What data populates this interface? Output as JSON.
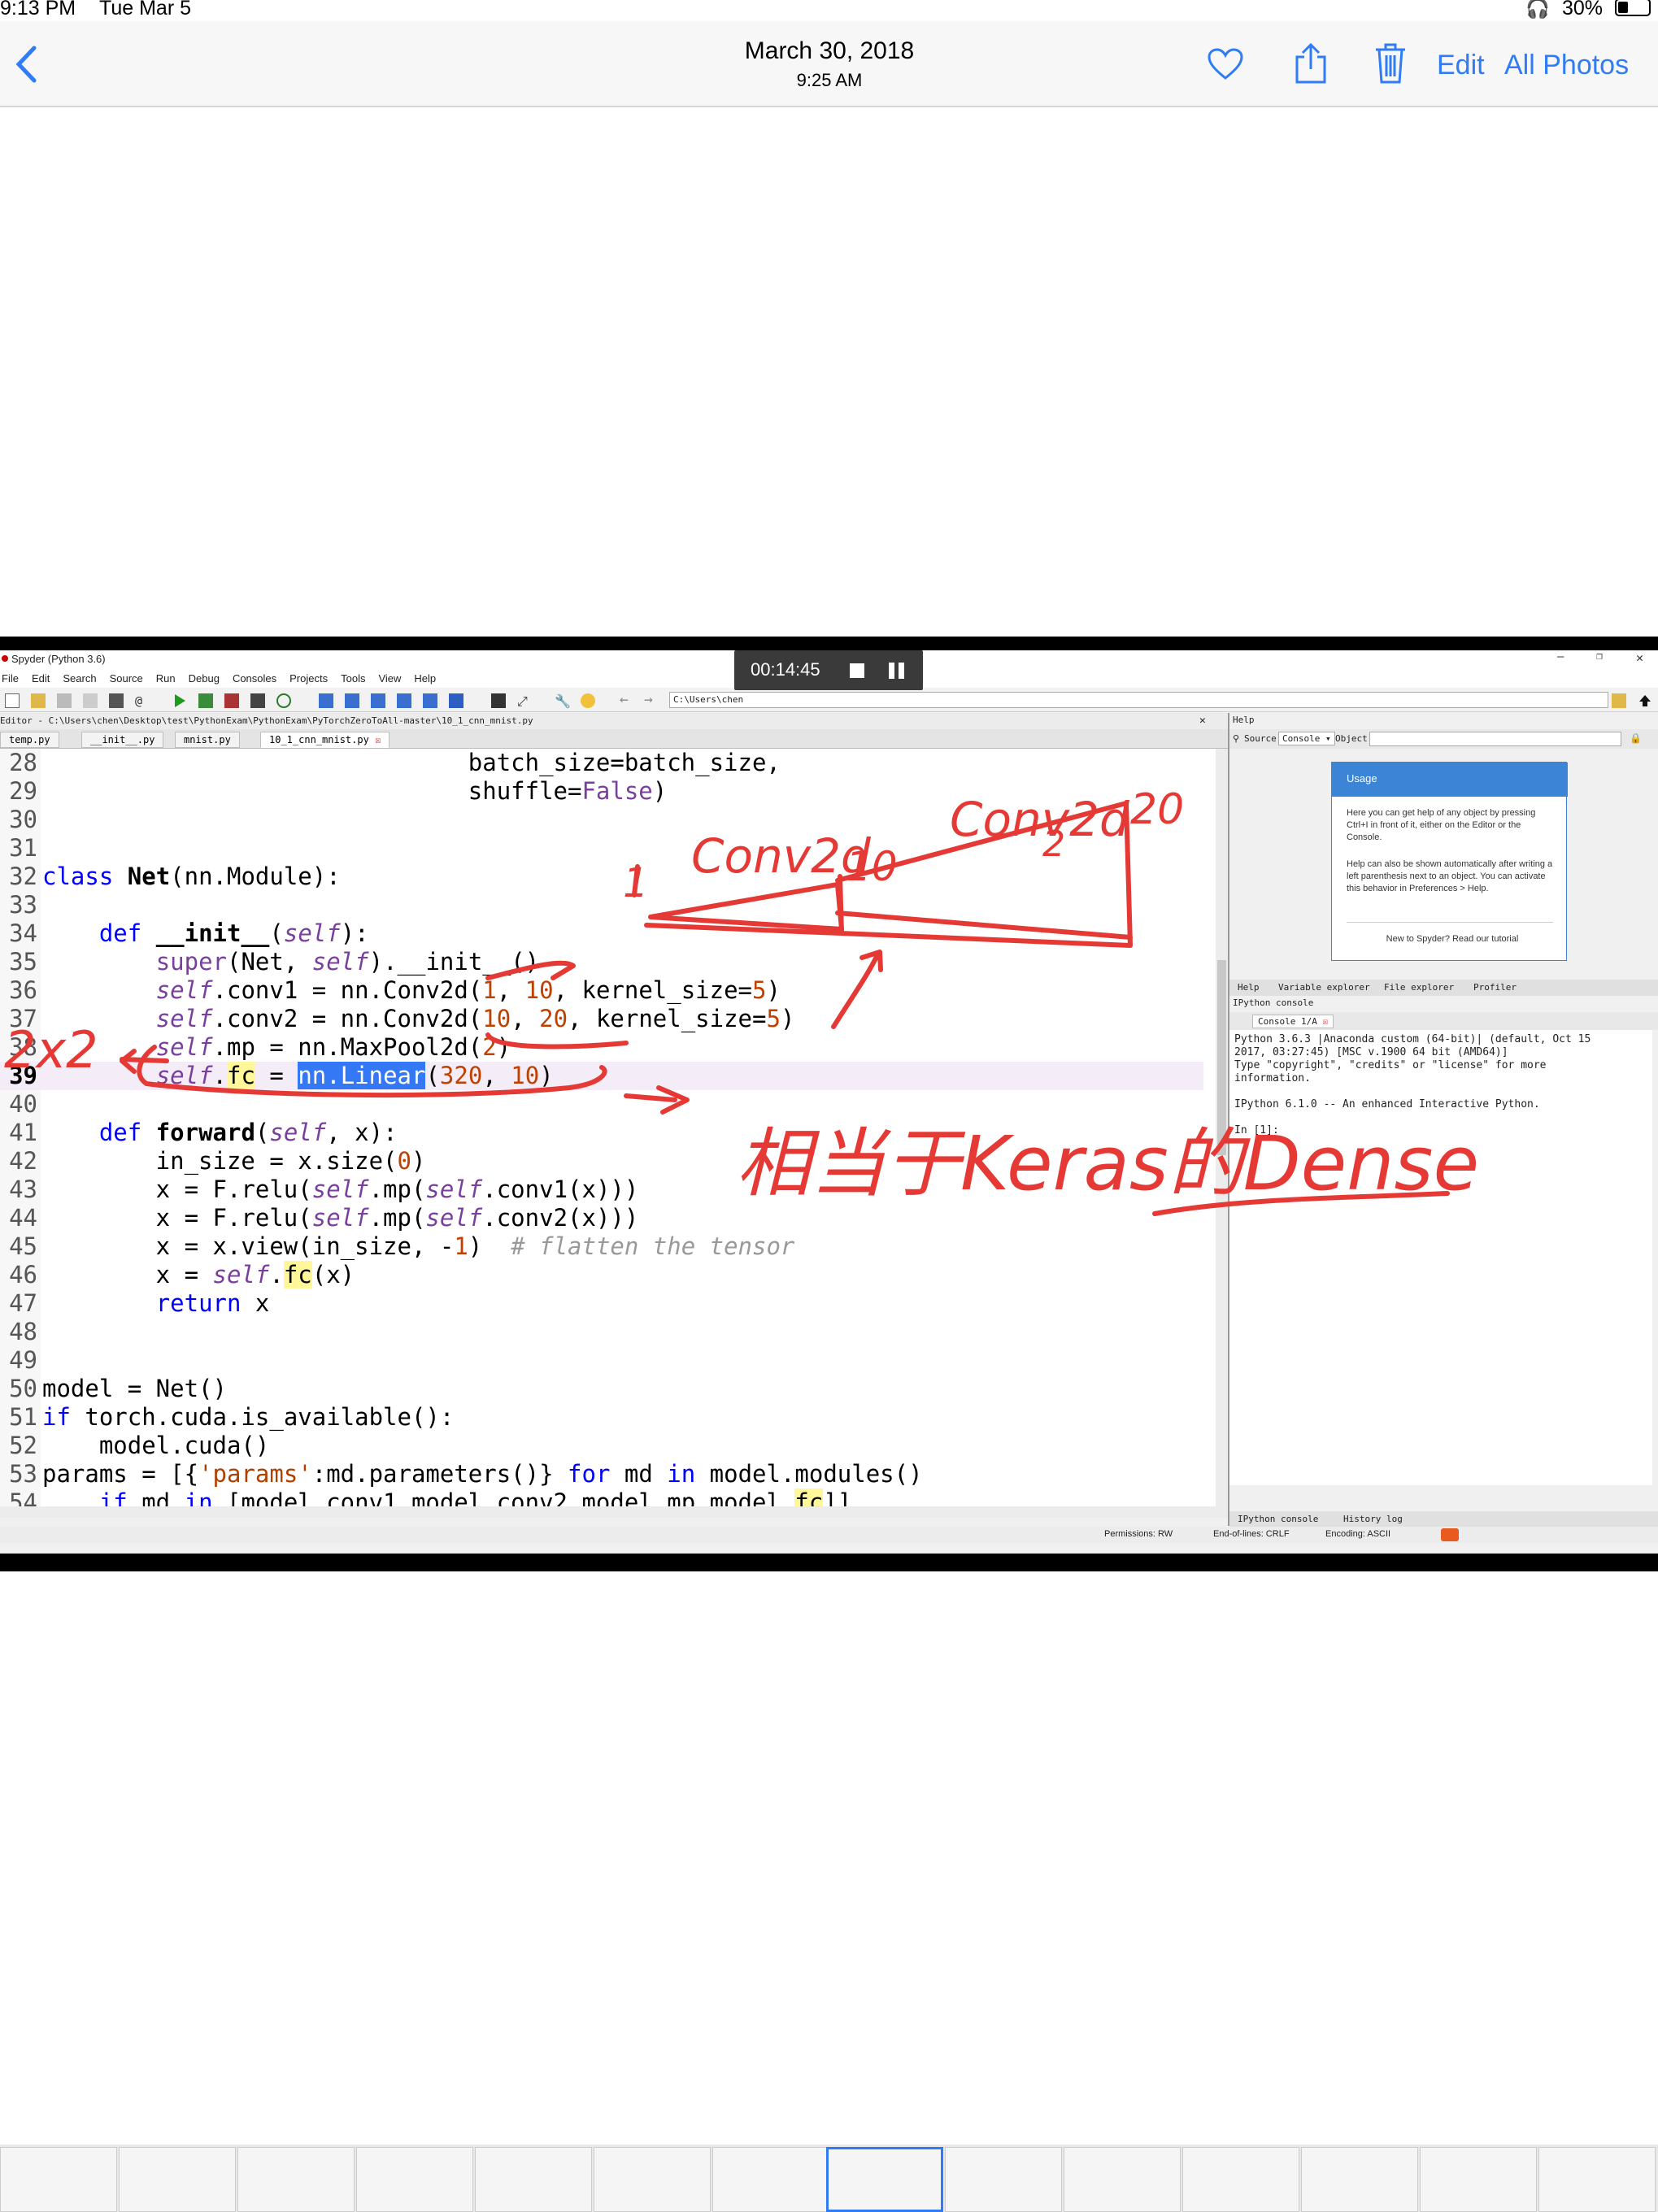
{
  "status_bar": {
    "time": "9:13 PM",
    "date": "Tue Mar 5",
    "battery": "30%"
  },
  "nav": {
    "date": "March 30, 2018",
    "time": "9:25 AM",
    "edit": "Edit",
    "all_photos": "All Photos"
  },
  "video": {
    "timer": "00:14:45"
  },
  "spyder": {
    "window_title": "Spyder (Python 3.6)",
    "menu": [
      "File",
      "Edit",
      "Search",
      "Source",
      "Run",
      "Debug",
      "Consoles",
      "Projects",
      "Tools",
      "View",
      "Help"
    ],
    "toolbar_path": "C:\\Users\\chen",
    "editor_path": "Editor - C:\\Users\\chen\\Desktop\\test\\PythonExam\\PythonExam\\PyTorchZeroToAll-master\\10_1_cnn_mnist.py",
    "tabs": [
      "temp.py",
      "__init__.py",
      "mnist.py",
      "10_1_cnn_mnist.py"
    ],
    "line_numbers": [
      "28",
      "29",
      "30",
      "31",
      "32",
      "33",
      "34",
      "35",
      "36",
      "37",
      "38",
      "39",
      "40",
      "41",
      "42",
      "43",
      "44",
      "45",
      "46",
      "47",
      "48",
      "49",
      "50",
      "51",
      "52",
      "53",
      "54"
    ],
    "help_label": "Help",
    "source_label": "Source",
    "console_select": "Console",
    "object_label": "Object",
    "usage_title": "Usage",
    "usage_p1": "Here you can get help of any object by pressing Ctrl+I in front of it, either on the Editor or the Console.",
    "usage_p2": "Help can also be shown automatically after writing a left parenthesis next to an object. You can activate this behavior in Preferences > Help.",
    "usage_p3": "New to Spyder? Read our tutorial",
    "pane_tabs": [
      "Help",
      "Variable explorer",
      "File explorer",
      "Profiler"
    ],
    "ipython_title": "IPython console",
    "console_tab": "Console 1/A",
    "console_text": "Python 3.6.3 |Anaconda custom (64-bit)| (default, Oct 15\n2017, 03:27:45) [MSC v.1900 64 bit (AMD64)]\nType \"copyright\", \"credits\" or \"license\" for more\ninformation.\n\nIPython 6.1.0 -- An enhanced Interactive Python.\n\nIn [1]:",
    "bottom_tabs": [
      "IPython console",
      "History log"
    ],
    "status": {
      "permissions": "Permissions: RW",
      "eol": "End-of-lines: CRLF",
      "encoding": "Encoding: ASCII"
    }
  },
  "annotations": {
    "conv2d_a": "Conv2d",
    "one": "1",
    "ten": "10",
    "conv2d_b": "Conv2d",
    "two": "2",
    "twenty": "20",
    "x2": "2x2",
    "note": "相当于Keras的Dense"
  },
  "colors": {
    "ios_blue": "#2f7cf6",
    "pen_red": "#e53935",
    "keyword": "#0000ff",
    "self": "#7a3f9e",
    "highlight": "#fff799",
    "selection": "#3478f6"
  }
}
